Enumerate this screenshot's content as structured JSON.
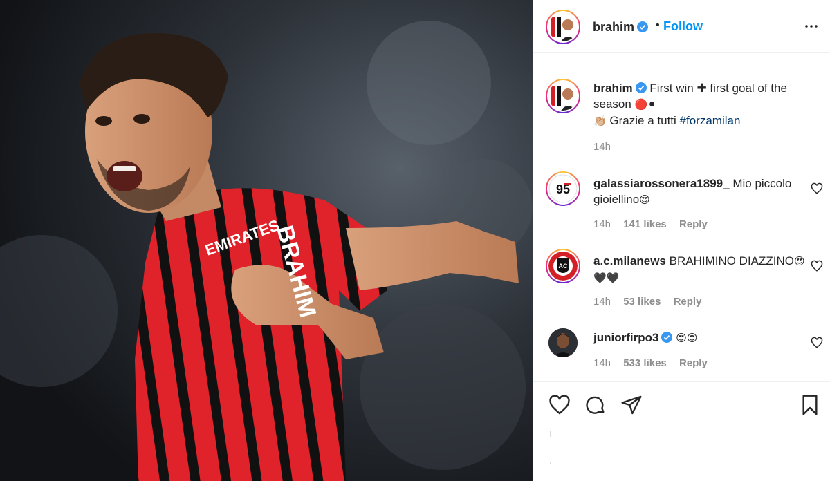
{
  "post": {
    "photo_alt": "Player celebrating in red and black striped kit"
  },
  "header": {
    "username": "brahim",
    "separator": "•",
    "follow_label": "Follow",
    "more_icon": "more-horizontal-icon"
  },
  "caption": {
    "username": "brahim",
    "text_1": "First win",
    "plus": "✚",
    "text_2": "first goal of the season",
    "emoji_balls": "🔴⚫",
    "clap": "👏🏼",
    "text_3": "Grazie a tutti",
    "hashtag": "#forzamilan",
    "time": "14h"
  },
  "comments": [
    {
      "username": "galassiarossonera1899_",
      "text": "Mio piccolo gioiellino",
      "emoji": "😍",
      "time": "14h",
      "likes": "141 likes",
      "reply": "Reply",
      "avatar_text": "95"
    },
    {
      "username": "a.c.milanews",
      "text": "BRAHIMINO DIAZZINO",
      "emoji": "😍🖤🖤",
      "time": "14h",
      "likes": "53 likes",
      "reply": "Reply",
      "avatar_text": "AC"
    },
    {
      "username": "juniorfirpo3",
      "text": "",
      "emoji": "😍😍",
      "time": "14h",
      "likes": "533 likes",
      "reply": "Reply"
    }
  ],
  "colors": {
    "link": "#0095f6",
    "hashtag": "#00376b",
    "muted": "#8e8e8e",
    "milan_red": "#d31f26"
  }
}
